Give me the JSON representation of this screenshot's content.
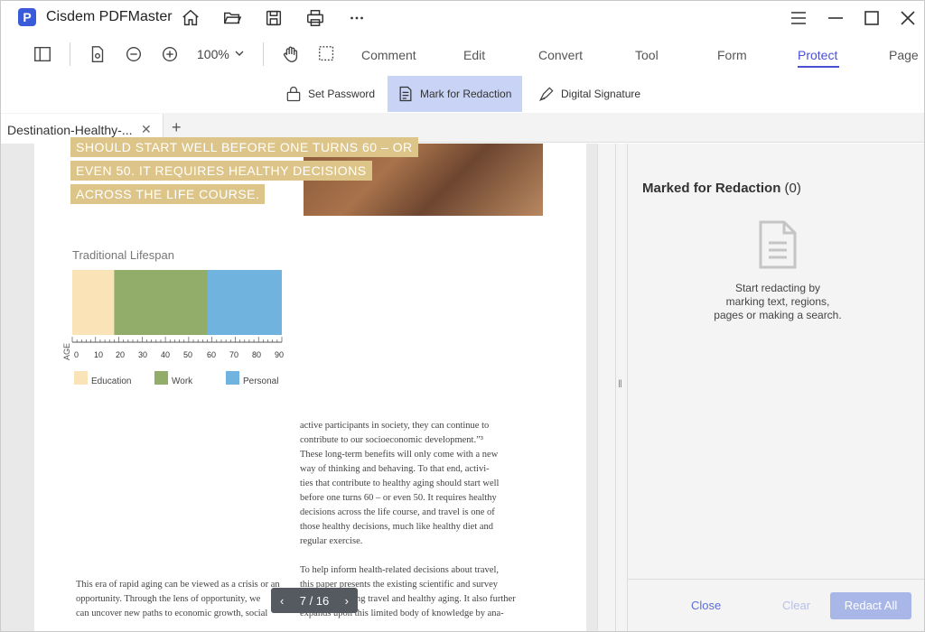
{
  "app": {
    "title": "Cisdem PDFMaster",
    "logo_letter": "P"
  },
  "toolbar": {
    "zoom": "100%"
  },
  "tabs": [
    {
      "label": "Comment"
    },
    {
      "label": "Edit"
    },
    {
      "label": "Convert"
    },
    {
      "label": "Tool"
    },
    {
      "label": "Form"
    },
    {
      "label": "Protect"
    },
    {
      "label": "Page"
    }
  ],
  "protect_tools": {
    "set_password": "Set Password",
    "mark_redaction": "Mark for Redaction",
    "digital_signature": "Digital Signature"
  },
  "document": {
    "tab_name": "Destination-Healthy-..."
  },
  "page": {
    "highlights": [
      "SHOULD START WELL BEFORE ONE TURNS 60 – OR",
      "EVEN 50. IT REQUIRES HEALTHY DECISIONS",
      "ACROSS THE LIFE COURSE."
    ],
    "chart_title": "Traditional Lifespan",
    "age_label": "AGE",
    "ticks": [
      "0",
      "10",
      "20",
      "30",
      "40",
      "50",
      "60",
      "70",
      "80",
      "90"
    ],
    "legend": [
      "Education",
      "Work",
      "Personal"
    ],
    "text_right": [
      "active participants in society, they can continue to",
      "contribute to our socioeconomic development.”³",
      "These long-term benefits will only come with a new",
      "way of thinking and behaving.  To that end, activi-",
      "ties that contribute to healthy aging should start well",
      "before one turns 60 – or even 50.  It requires healthy",
      "decisions across the life course, and travel is one of",
      "those healthy decisions, much like healthy diet and",
      "regular exercise."
    ],
    "text_right2": [
      "To help inform health-related decisions about travel,",
      "this paper presents the existing scientific and survey",
      "ng travel and healthy aging.  It also further",
      "expands upon this limited body of knowledge by ana-"
    ],
    "text_left": [
      "This era of rapid aging can be viewed as a crisis or an",
      "opportunity.  Through the lens of opportunity, we",
      "can uncover new paths to economic growth, social"
    ],
    "page_indicator": "7 / 16"
  },
  "chart_data": {
    "type": "bar",
    "title": "Traditional Lifespan",
    "xlabel": "AGE",
    "xlim": [
      0,
      90
    ],
    "series": [
      {
        "name": "Education",
        "start": 0,
        "end": 18,
        "color": "#fbe3b8"
      },
      {
        "name": "Work",
        "start": 18,
        "end": 58,
        "color": "#92ad6a"
      },
      {
        "name": "Personal",
        "start": 58,
        "end": 90,
        "color": "#6fb3de"
      }
    ]
  },
  "redaction_panel": {
    "title": "Marked for Redaction",
    "count": "(0)",
    "hint_lines": [
      "Start redacting by",
      "marking text, regions,",
      "pages or making a search."
    ],
    "close": "Close",
    "clear": "Clear",
    "redact_all": "Redact All"
  }
}
